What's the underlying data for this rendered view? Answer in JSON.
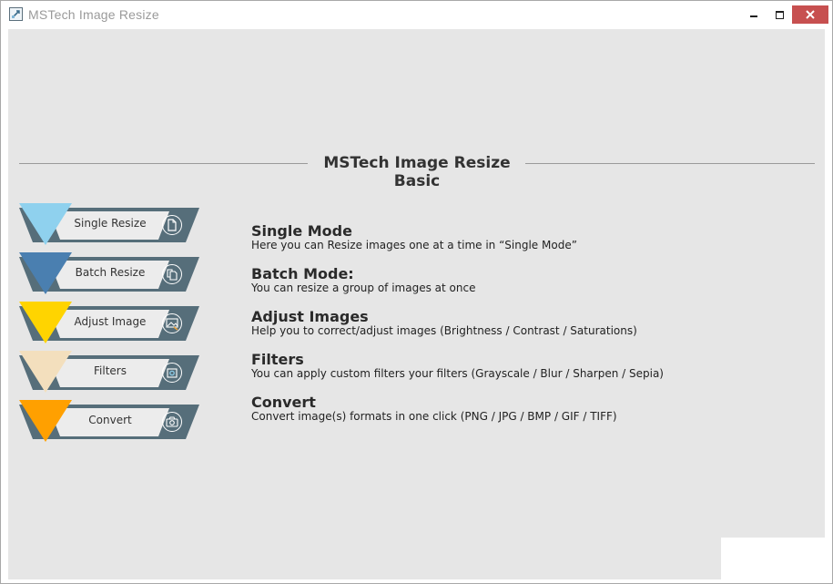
{
  "window": {
    "title": "MSTech Image Resize"
  },
  "header": {
    "title": "MSTech Image Resize Basic"
  },
  "menu": [
    {
      "label": "Single Resize",
      "color": "#8fd1ee",
      "icon": "document-icon"
    },
    {
      "label": "Batch Resize",
      "color": "#4a7fb0",
      "icon": "documents-icon"
    },
    {
      "label": "Adjust Image",
      "color": "#ffd400",
      "icon": "image-adjust-icon"
    },
    {
      "label": "Filters",
      "color": "#f3dfbd",
      "icon": "filter-icon"
    },
    {
      "label": "Convert",
      "color": "#ffa000",
      "icon": "camera-icon"
    }
  ],
  "descriptions": [
    {
      "title": "Single Mode",
      "text": "Here you can Resize images one at a time in “Single Mode”"
    },
    {
      "title": "Batch Mode:",
      "text": "You can resize a group of images at once"
    },
    {
      "title": "Adjust Images",
      "text": "Help you to correct/adjust images (Brightness / Contrast / Saturations)"
    },
    {
      "title": "Filters",
      "text": "You can apply custom filters your filters (Grayscale / Blur / Sharpen / Sepia)"
    },
    {
      "title": "Convert",
      "text": "Convert image(s) formats in one click (PNG / JPG / BMP / GIF / TIFF)"
    }
  ],
  "colors": {
    "band": "#566e7a",
    "card": "#ececec",
    "background": "#e6e6e6",
    "close": "#c75050"
  }
}
